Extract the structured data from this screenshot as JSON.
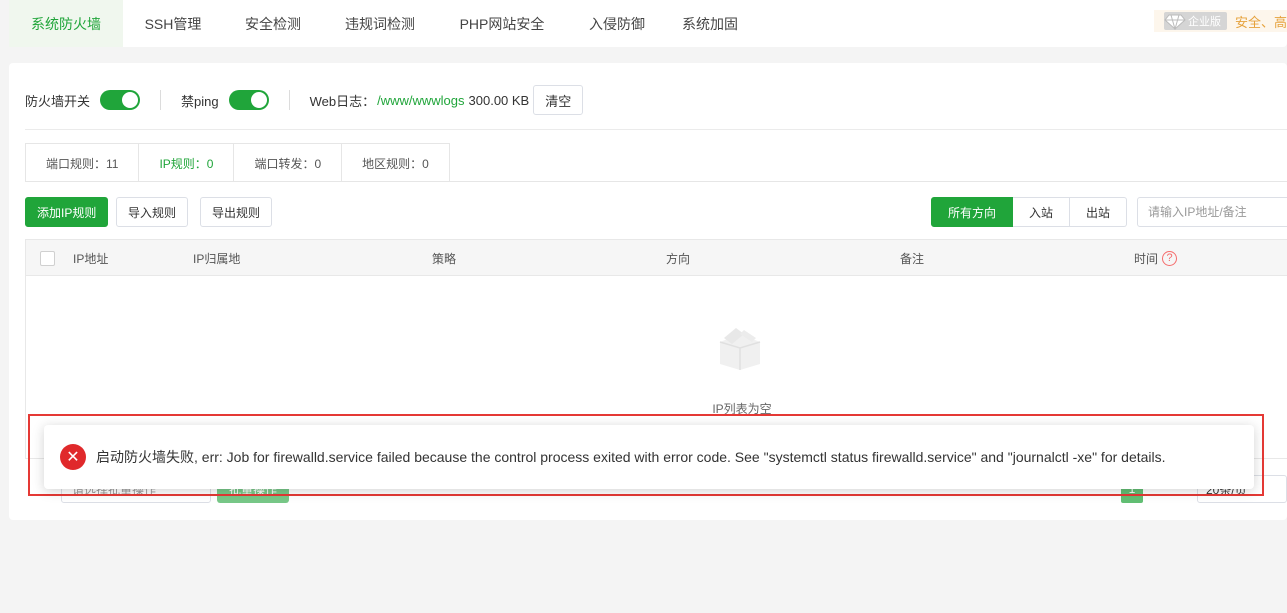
{
  "nav": {
    "tabs": [
      "系统防火墙",
      "SSH管理",
      "安全检测",
      "违规词检测",
      "PHP网站安全",
      "入侵防御",
      "系统加固"
    ],
    "enterprise_badge": "企业版",
    "right_text": "安全、高"
  },
  "toolbar": {
    "firewall_label": "防火墙开关",
    "ping_label": "禁ping",
    "web_log_label": "Web日志：",
    "web_log_path": "/www/wwwlogs",
    "web_log_size": "300.00 KB",
    "clear_label": "清空"
  },
  "rule_tabs": [
    "端口规则：11",
    "IP规则：0",
    "端口转发：0",
    "地区规则：0"
  ],
  "actions": {
    "add_ip_rule": "添加IP规则",
    "import_rules": "导入规则",
    "export_rules": "导出规则",
    "direction": [
      "所有方向",
      "入站",
      "出站"
    ],
    "search_placeholder": "请输入IP地址/备注"
  },
  "table": {
    "columns": [
      "IP地址",
      "IP归属地",
      "策略",
      "方向",
      "备注",
      "时间"
    ],
    "help_icon": "?",
    "empty_text": "IP列表为空"
  },
  "pager": {
    "batch_placeholder": "请选择批量操作",
    "batch_button": "批量操作",
    "current_page": "1",
    "page_size": "20条/页"
  },
  "toast": {
    "icon": "✕",
    "message": "启动防火墙失败, err: Job for firewalld.service failed because the control process exited with error code. See \"systemctl status firewalld.service\" and \"journalctl -xe\" for details."
  }
}
